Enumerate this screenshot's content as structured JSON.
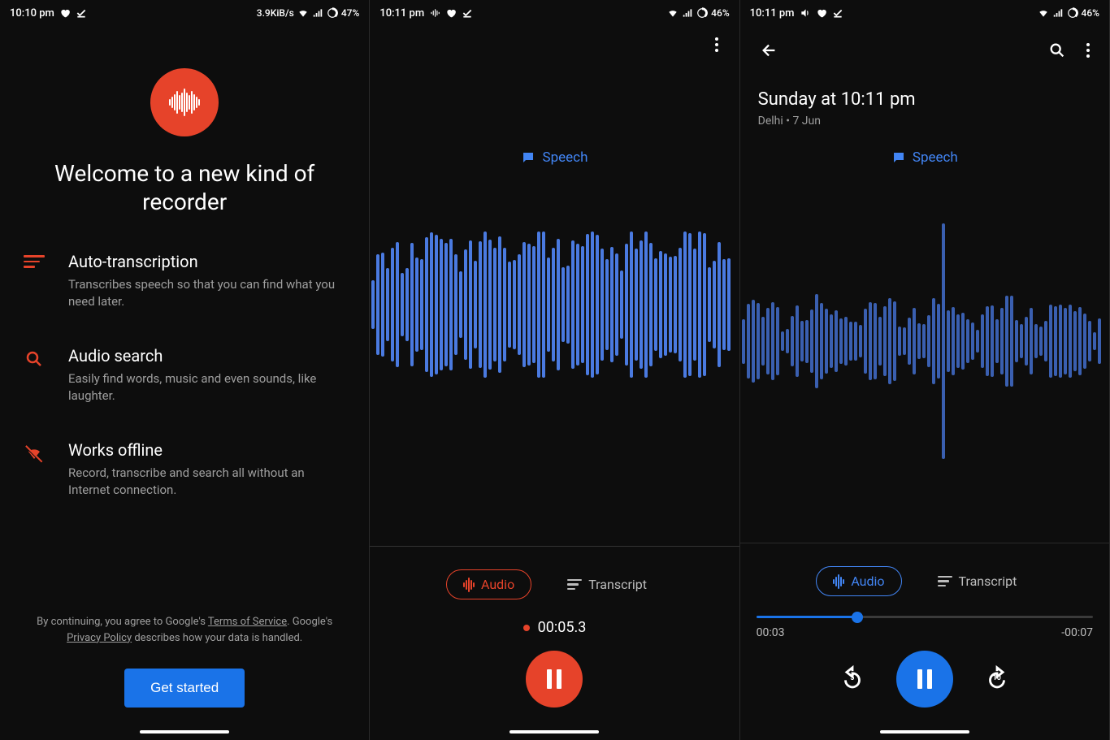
{
  "screen1": {
    "status": {
      "time": "10:10 pm",
      "net": "3.9KiB/s",
      "battery": "47%"
    },
    "title": "Welcome to a new kind of recorder",
    "features": [
      {
        "heading": "Auto-transcription",
        "body": "Transcribes speech so that you can find what you need later."
      },
      {
        "heading": "Audio search",
        "body": "Easily find words, music and even sounds, like laughter."
      },
      {
        "heading": "Works offline",
        "body": "Record, transcribe and search all without an Internet connection."
      }
    ],
    "legal_pre": "By continuing, you agree to Google's ",
    "legal_tos": "Terms of Service",
    "legal_mid": ". Google's ",
    "legal_pp": "Privacy Policy",
    "legal_post": " describes how your data is handled.",
    "cta": "Get started"
  },
  "screen2": {
    "status": {
      "time": "10:11 pm",
      "battery": "46%"
    },
    "speech_label": "Speech",
    "tabs": {
      "audio": "Audio",
      "transcript": "Transcript"
    },
    "time": "00:05.3"
  },
  "screen3": {
    "status": {
      "time": "10:11 pm",
      "battery": "46%"
    },
    "title": "Sunday at 10:11 pm",
    "subtitle": "Delhi • 7 Jun",
    "speech_label": "Speech",
    "tabs": {
      "audio": "Audio",
      "transcript": "Transcript"
    },
    "progress_percent": 30,
    "elapsed": "00:03",
    "remaining": "-00:07",
    "skip_back": "5",
    "skip_fwd": "10"
  }
}
